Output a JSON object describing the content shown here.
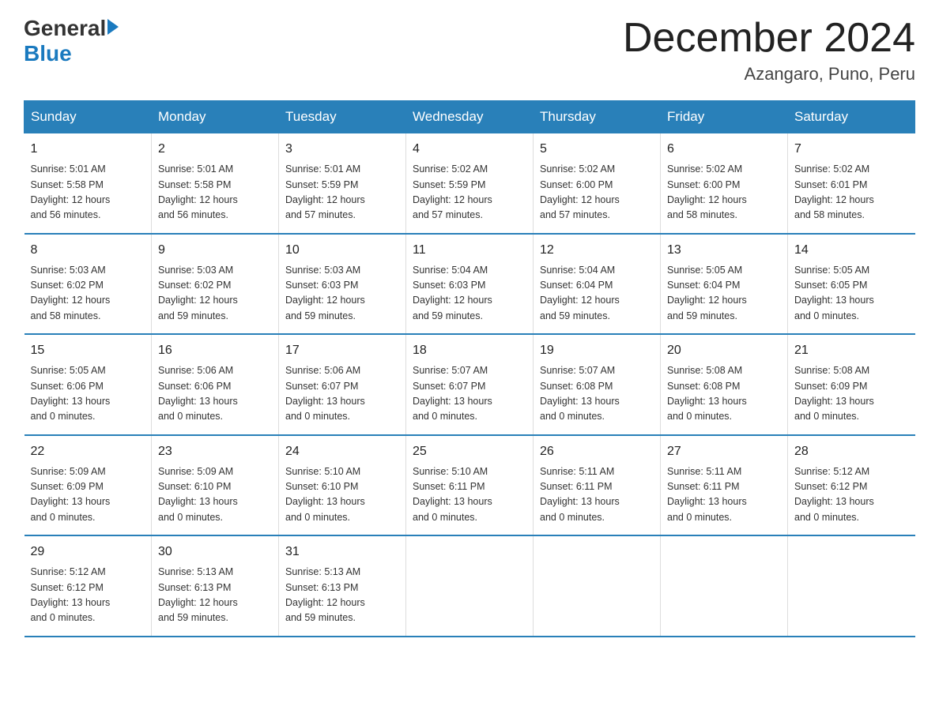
{
  "header": {
    "logo_general": "General",
    "logo_blue": "Blue",
    "month_title": "December 2024",
    "location": "Azangaro, Puno, Peru"
  },
  "days_of_week": [
    "Sunday",
    "Monday",
    "Tuesday",
    "Wednesday",
    "Thursday",
    "Friday",
    "Saturday"
  ],
  "weeks": [
    [
      {
        "day": "1",
        "sunrise": "5:01 AM",
        "sunset": "5:58 PM",
        "daylight": "12 hours and 56 minutes."
      },
      {
        "day": "2",
        "sunrise": "5:01 AM",
        "sunset": "5:58 PM",
        "daylight": "12 hours and 56 minutes."
      },
      {
        "day": "3",
        "sunrise": "5:01 AM",
        "sunset": "5:59 PM",
        "daylight": "12 hours and 57 minutes."
      },
      {
        "day": "4",
        "sunrise": "5:02 AM",
        "sunset": "5:59 PM",
        "daylight": "12 hours and 57 minutes."
      },
      {
        "day": "5",
        "sunrise": "5:02 AM",
        "sunset": "6:00 PM",
        "daylight": "12 hours and 57 minutes."
      },
      {
        "day": "6",
        "sunrise": "5:02 AM",
        "sunset": "6:00 PM",
        "daylight": "12 hours and 58 minutes."
      },
      {
        "day": "7",
        "sunrise": "5:02 AM",
        "sunset": "6:01 PM",
        "daylight": "12 hours and 58 minutes."
      }
    ],
    [
      {
        "day": "8",
        "sunrise": "5:03 AM",
        "sunset": "6:02 PM",
        "daylight": "12 hours and 58 minutes."
      },
      {
        "day": "9",
        "sunrise": "5:03 AM",
        "sunset": "6:02 PM",
        "daylight": "12 hours and 59 minutes."
      },
      {
        "day": "10",
        "sunrise": "5:03 AM",
        "sunset": "6:03 PM",
        "daylight": "12 hours and 59 minutes."
      },
      {
        "day": "11",
        "sunrise": "5:04 AM",
        "sunset": "6:03 PM",
        "daylight": "12 hours and 59 minutes."
      },
      {
        "day": "12",
        "sunrise": "5:04 AM",
        "sunset": "6:04 PM",
        "daylight": "12 hours and 59 minutes."
      },
      {
        "day": "13",
        "sunrise": "5:05 AM",
        "sunset": "6:04 PM",
        "daylight": "12 hours and 59 minutes."
      },
      {
        "day": "14",
        "sunrise": "5:05 AM",
        "sunset": "6:05 PM",
        "daylight": "13 hours and 0 minutes."
      }
    ],
    [
      {
        "day": "15",
        "sunrise": "5:05 AM",
        "sunset": "6:06 PM",
        "daylight": "13 hours and 0 minutes."
      },
      {
        "day": "16",
        "sunrise": "5:06 AM",
        "sunset": "6:06 PM",
        "daylight": "13 hours and 0 minutes."
      },
      {
        "day": "17",
        "sunrise": "5:06 AM",
        "sunset": "6:07 PM",
        "daylight": "13 hours and 0 minutes."
      },
      {
        "day": "18",
        "sunrise": "5:07 AM",
        "sunset": "6:07 PM",
        "daylight": "13 hours and 0 minutes."
      },
      {
        "day": "19",
        "sunrise": "5:07 AM",
        "sunset": "6:08 PM",
        "daylight": "13 hours and 0 minutes."
      },
      {
        "day": "20",
        "sunrise": "5:08 AM",
        "sunset": "6:08 PM",
        "daylight": "13 hours and 0 minutes."
      },
      {
        "day": "21",
        "sunrise": "5:08 AM",
        "sunset": "6:09 PM",
        "daylight": "13 hours and 0 minutes."
      }
    ],
    [
      {
        "day": "22",
        "sunrise": "5:09 AM",
        "sunset": "6:09 PM",
        "daylight": "13 hours and 0 minutes."
      },
      {
        "day": "23",
        "sunrise": "5:09 AM",
        "sunset": "6:10 PM",
        "daylight": "13 hours and 0 minutes."
      },
      {
        "day": "24",
        "sunrise": "5:10 AM",
        "sunset": "6:10 PM",
        "daylight": "13 hours and 0 minutes."
      },
      {
        "day": "25",
        "sunrise": "5:10 AM",
        "sunset": "6:11 PM",
        "daylight": "13 hours and 0 minutes."
      },
      {
        "day": "26",
        "sunrise": "5:11 AM",
        "sunset": "6:11 PM",
        "daylight": "13 hours and 0 minutes."
      },
      {
        "day": "27",
        "sunrise": "5:11 AM",
        "sunset": "6:11 PM",
        "daylight": "13 hours and 0 minutes."
      },
      {
        "day": "28",
        "sunrise": "5:12 AM",
        "sunset": "6:12 PM",
        "daylight": "13 hours and 0 minutes."
      }
    ],
    [
      {
        "day": "29",
        "sunrise": "5:12 AM",
        "sunset": "6:12 PM",
        "daylight": "13 hours and 0 minutes."
      },
      {
        "day": "30",
        "sunrise": "5:13 AM",
        "sunset": "6:13 PM",
        "daylight": "12 hours and 59 minutes."
      },
      {
        "day": "31",
        "sunrise": "5:13 AM",
        "sunset": "6:13 PM",
        "daylight": "12 hours and 59 minutes."
      },
      null,
      null,
      null,
      null
    ]
  ],
  "labels": {
    "sunrise": "Sunrise:",
    "sunset": "Sunset:",
    "daylight": "Daylight:"
  }
}
